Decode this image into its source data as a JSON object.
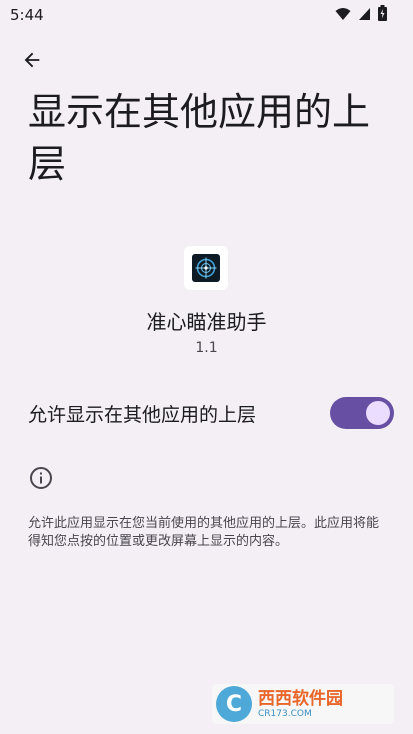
{
  "status_bar": {
    "time": "5:44",
    "icons": [
      "wifi-icon",
      "signal-icon",
      "battery-icon"
    ]
  },
  "header": {
    "back_icon": "arrow-back-icon",
    "title": "显示在其他应用的上层"
  },
  "app": {
    "icon": "crosshair-app-icon",
    "name": "准心瞄准助手",
    "version": "1.1"
  },
  "permission": {
    "label": "允许显示在其他应用的上层",
    "enabled": true
  },
  "info": {
    "icon": "info-icon",
    "description": "允许此应用显示在您当前使用的其他应用的上层。此应用将能得知您点按的位置或更改屏幕上显示的内容。"
  },
  "watermark": {
    "logo_letter": "C",
    "name": "西西软件园",
    "url": "CR173.COM"
  },
  "colors": {
    "background": "#f4eff4",
    "switch_track": "#6750a4",
    "switch_thumb": "#eaddff",
    "watermark_orange": "#e8662a",
    "watermark_blue": "#4ea9d8"
  }
}
